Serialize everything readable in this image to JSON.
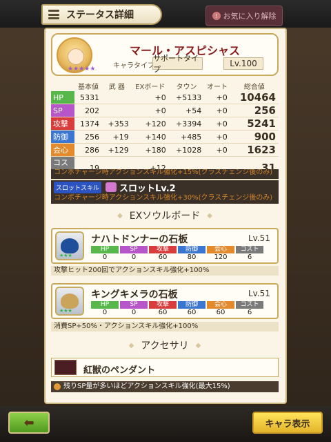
{
  "header": {
    "title": "ステータス詳細",
    "favorite_label": "お気に入り解除"
  },
  "character": {
    "name": "マール・アスピシャス",
    "type_label": "キャラタイプ",
    "type": "サポートタイプ",
    "level": "Lv.100"
  },
  "stats": {
    "headers": [
      "",
      "基本値",
      "武 器",
      "EXボード",
      "タウン",
      "オート",
      "総合値"
    ],
    "rows": [
      {
        "label": "HP",
        "base": "5331",
        "weapon": "",
        "ex": "+0",
        "town": "+5133",
        "auto": "+0",
        "total": "10464"
      },
      {
        "label": "SP",
        "base": "202",
        "weapon": "",
        "ex": "+0",
        "town": "+54",
        "auto": "+0",
        "total": "256"
      },
      {
        "label": "攻撃",
        "base": "1374",
        "weapon": "+353",
        "ex": "+120",
        "town": "+3394",
        "auto": "+0",
        "total": "5241"
      },
      {
        "label": "防御",
        "base": "256",
        "weapon": "+19",
        "ex": "+140",
        "town": "+485",
        "auto": "+0",
        "total": "900"
      },
      {
        "label": "会心",
        "base": "286",
        "weapon": "+129",
        "ex": "+180",
        "town": "+1028",
        "auto": "+0",
        "total": "1623"
      },
      {
        "label": "コスト",
        "base": "19",
        "weapon": "",
        "ex": "+12",
        "town": "",
        "auto": "",
        "total": "31"
      }
    ]
  },
  "skill_cut": "コンボチャージ時アクションスキル強化+15%(クラスチェンジ後のみ)",
  "slot": {
    "badge": "スロットスキル",
    "level": "スロットLv.2",
    "desc": "コンボチャージ時アクションスキル強化+30%(クラスチェンジ後のみ)"
  },
  "ex_section": "EXソウルボード",
  "stat_headers": [
    "HP",
    "SP",
    "攻撃",
    "防御",
    "会心",
    "コスト"
  ],
  "boards": [
    {
      "name": "ナハトドンナーの石板",
      "level": "Lv.51",
      "values": [
        "0",
        "0",
        "60",
        "80",
        "120",
        "6"
      ],
      "desc": "攻撃ヒット200回でアクションスキル強化+100%"
    },
    {
      "name": "キングキメラの石板",
      "level": "Lv.51",
      "values": [
        "0",
        "0",
        "60",
        "60",
        "60",
        "6"
      ],
      "desc": "消費SP+50%・アクションスキル強化+100%"
    }
  ],
  "acc_section": "アクセサリ",
  "accessory": {
    "name": "紅獣のペンダント",
    "desc": "残りSP量が多いほどアクションスキル強化(最大15%)"
  },
  "footer": {
    "char_button": "キャラ表示"
  },
  "icons": {
    "back": "back-arrow-icon",
    "menu": "menu-icon",
    "heart": "heart-icon"
  }
}
